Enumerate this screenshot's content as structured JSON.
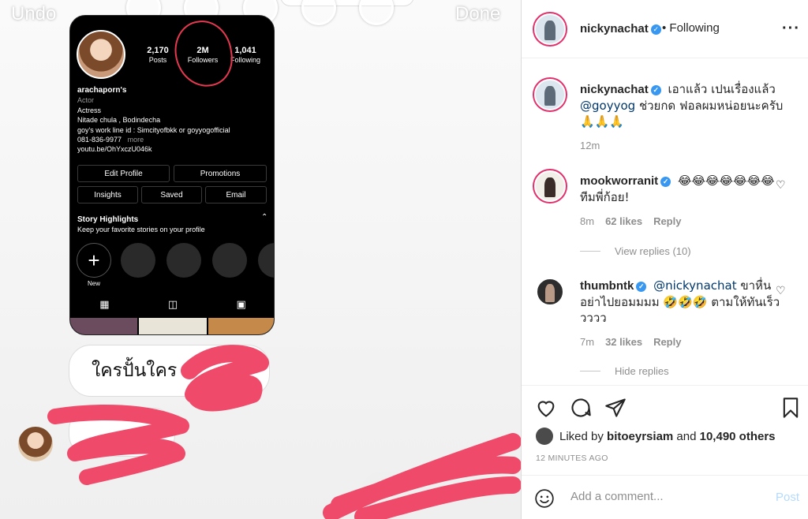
{
  "story": {
    "undo_label": "Undo",
    "done_label": "Done",
    "profile": {
      "posts_count": "2,170",
      "posts_label": "Posts",
      "followers_count": "2M",
      "followers_label": "Followers",
      "following_count": "1,041",
      "following_label": "Following",
      "display_name": "arachaporn's",
      "category": "Actor",
      "bio_lines": [
        "Actress",
        "Nitade chula , Bodindecha",
        "goy's work line id : Simcityofbkk or goyyogofficial",
        "081-836-9977"
      ],
      "more_label": "more",
      "link": "youtu.be/OhYxczU046k",
      "buttons": {
        "edit_profile": "Edit Profile",
        "promotions": "Promotions",
        "insights": "Insights",
        "saved": "Saved",
        "email": "Email"
      },
      "highlights_title": "Story Highlights",
      "highlights_sub": "Keep your favorite stories on your profile",
      "new_label": "New"
    },
    "message_1": "ใครปั้นใคร"
  },
  "post": {
    "header": {
      "username": "nickynachat",
      "follow_status": "• Following"
    },
    "caption": {
      "username": "nickynachat",
      "text_1": "เอาแล้ว เปนเรื่องแล้ว",
      "mention": "@goyyog",
      "text_2": "ช่วยกด ฟอลผมหน่อยนะครับ",
      "emojis": "🙏🙏🙏",
      "time": "12m"
    },
    "comments": [
      {
        "username": "mookworranit",
        "text": "😂😂😂😂😂😂😂 ทีมพี่ก้อย!",
        "time": "8m",
        "likes": "62 likes",
        "reply": "Reply",
        "replies_toggle": "View replies (10)"
      },
      {
        "username": "thumbntk",
        "mention": "@nickynachat",
        "text": "ขาหื่นอย่าไปยอมมมม 🤣🤣🤣 ตามให้ทันเร็ววววว",
        "time": "7m",
        "likes": "32 likes",
        "reply": "Reply",
        "replies_toggle": "Hide replies"
      }
    ],
    "liked_by_prefix": "Liked by",
    "liked_by_user": "bitoeyrsiam",
    "liked_by_suffix": "and",
    "others_count": "10,490 others",
    "timestamp": "12 MINUTES AGO",
    "comment_placeholder": "Add a comment...",
    "post_label": "Post"
  },
  "colors": {
    "verified": "#3897f0",
    "scribble": "#f04a6a",
    "post_disabled": "#b3dbff"
  }
}
